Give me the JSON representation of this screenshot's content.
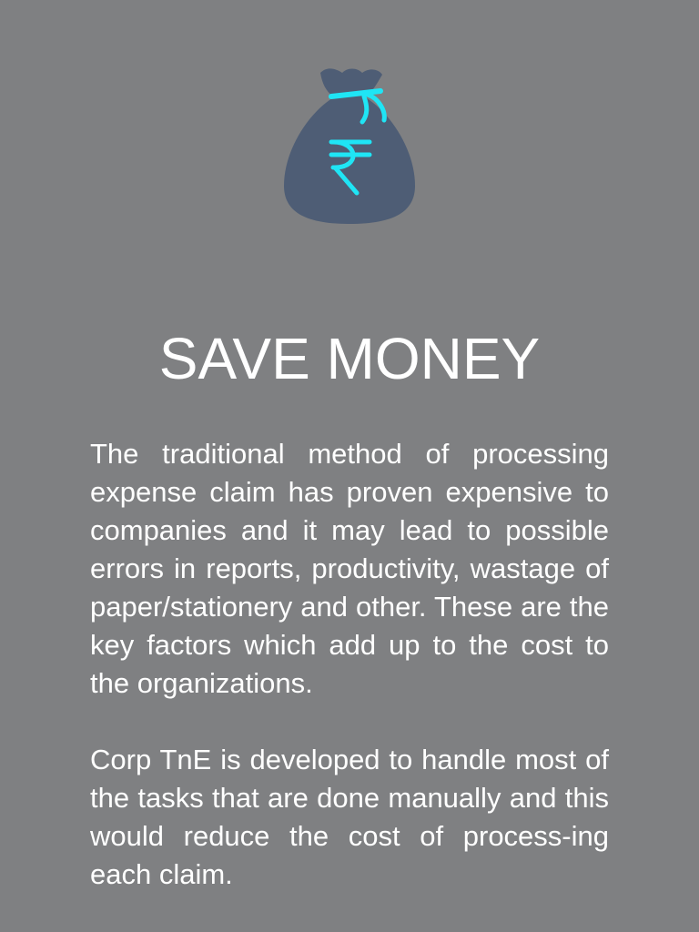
{
  "hero": {
    "icon": "money-bag-rupee-icon",
    "bag_color": "#4e5d75",
    "accent_color": "#1fe5f5"
  },
  "title": "SAVE MONEY",
  "paragraphs": [
    "The traditional method of processing expense claim has proven expensive to companies and it may lead to possible errors in reports, productivity, wastage of paper/stationery and other. These are the key factors which add up to the cost to the organizations.",
    "Corp TnE is developed to handle most of the tasks that are done manually and this would reduce the cost of process-ing each claim."
  ],
  "colors": {
    "background": "#7f8082",
    "text": "#ffffff"
  }
}
